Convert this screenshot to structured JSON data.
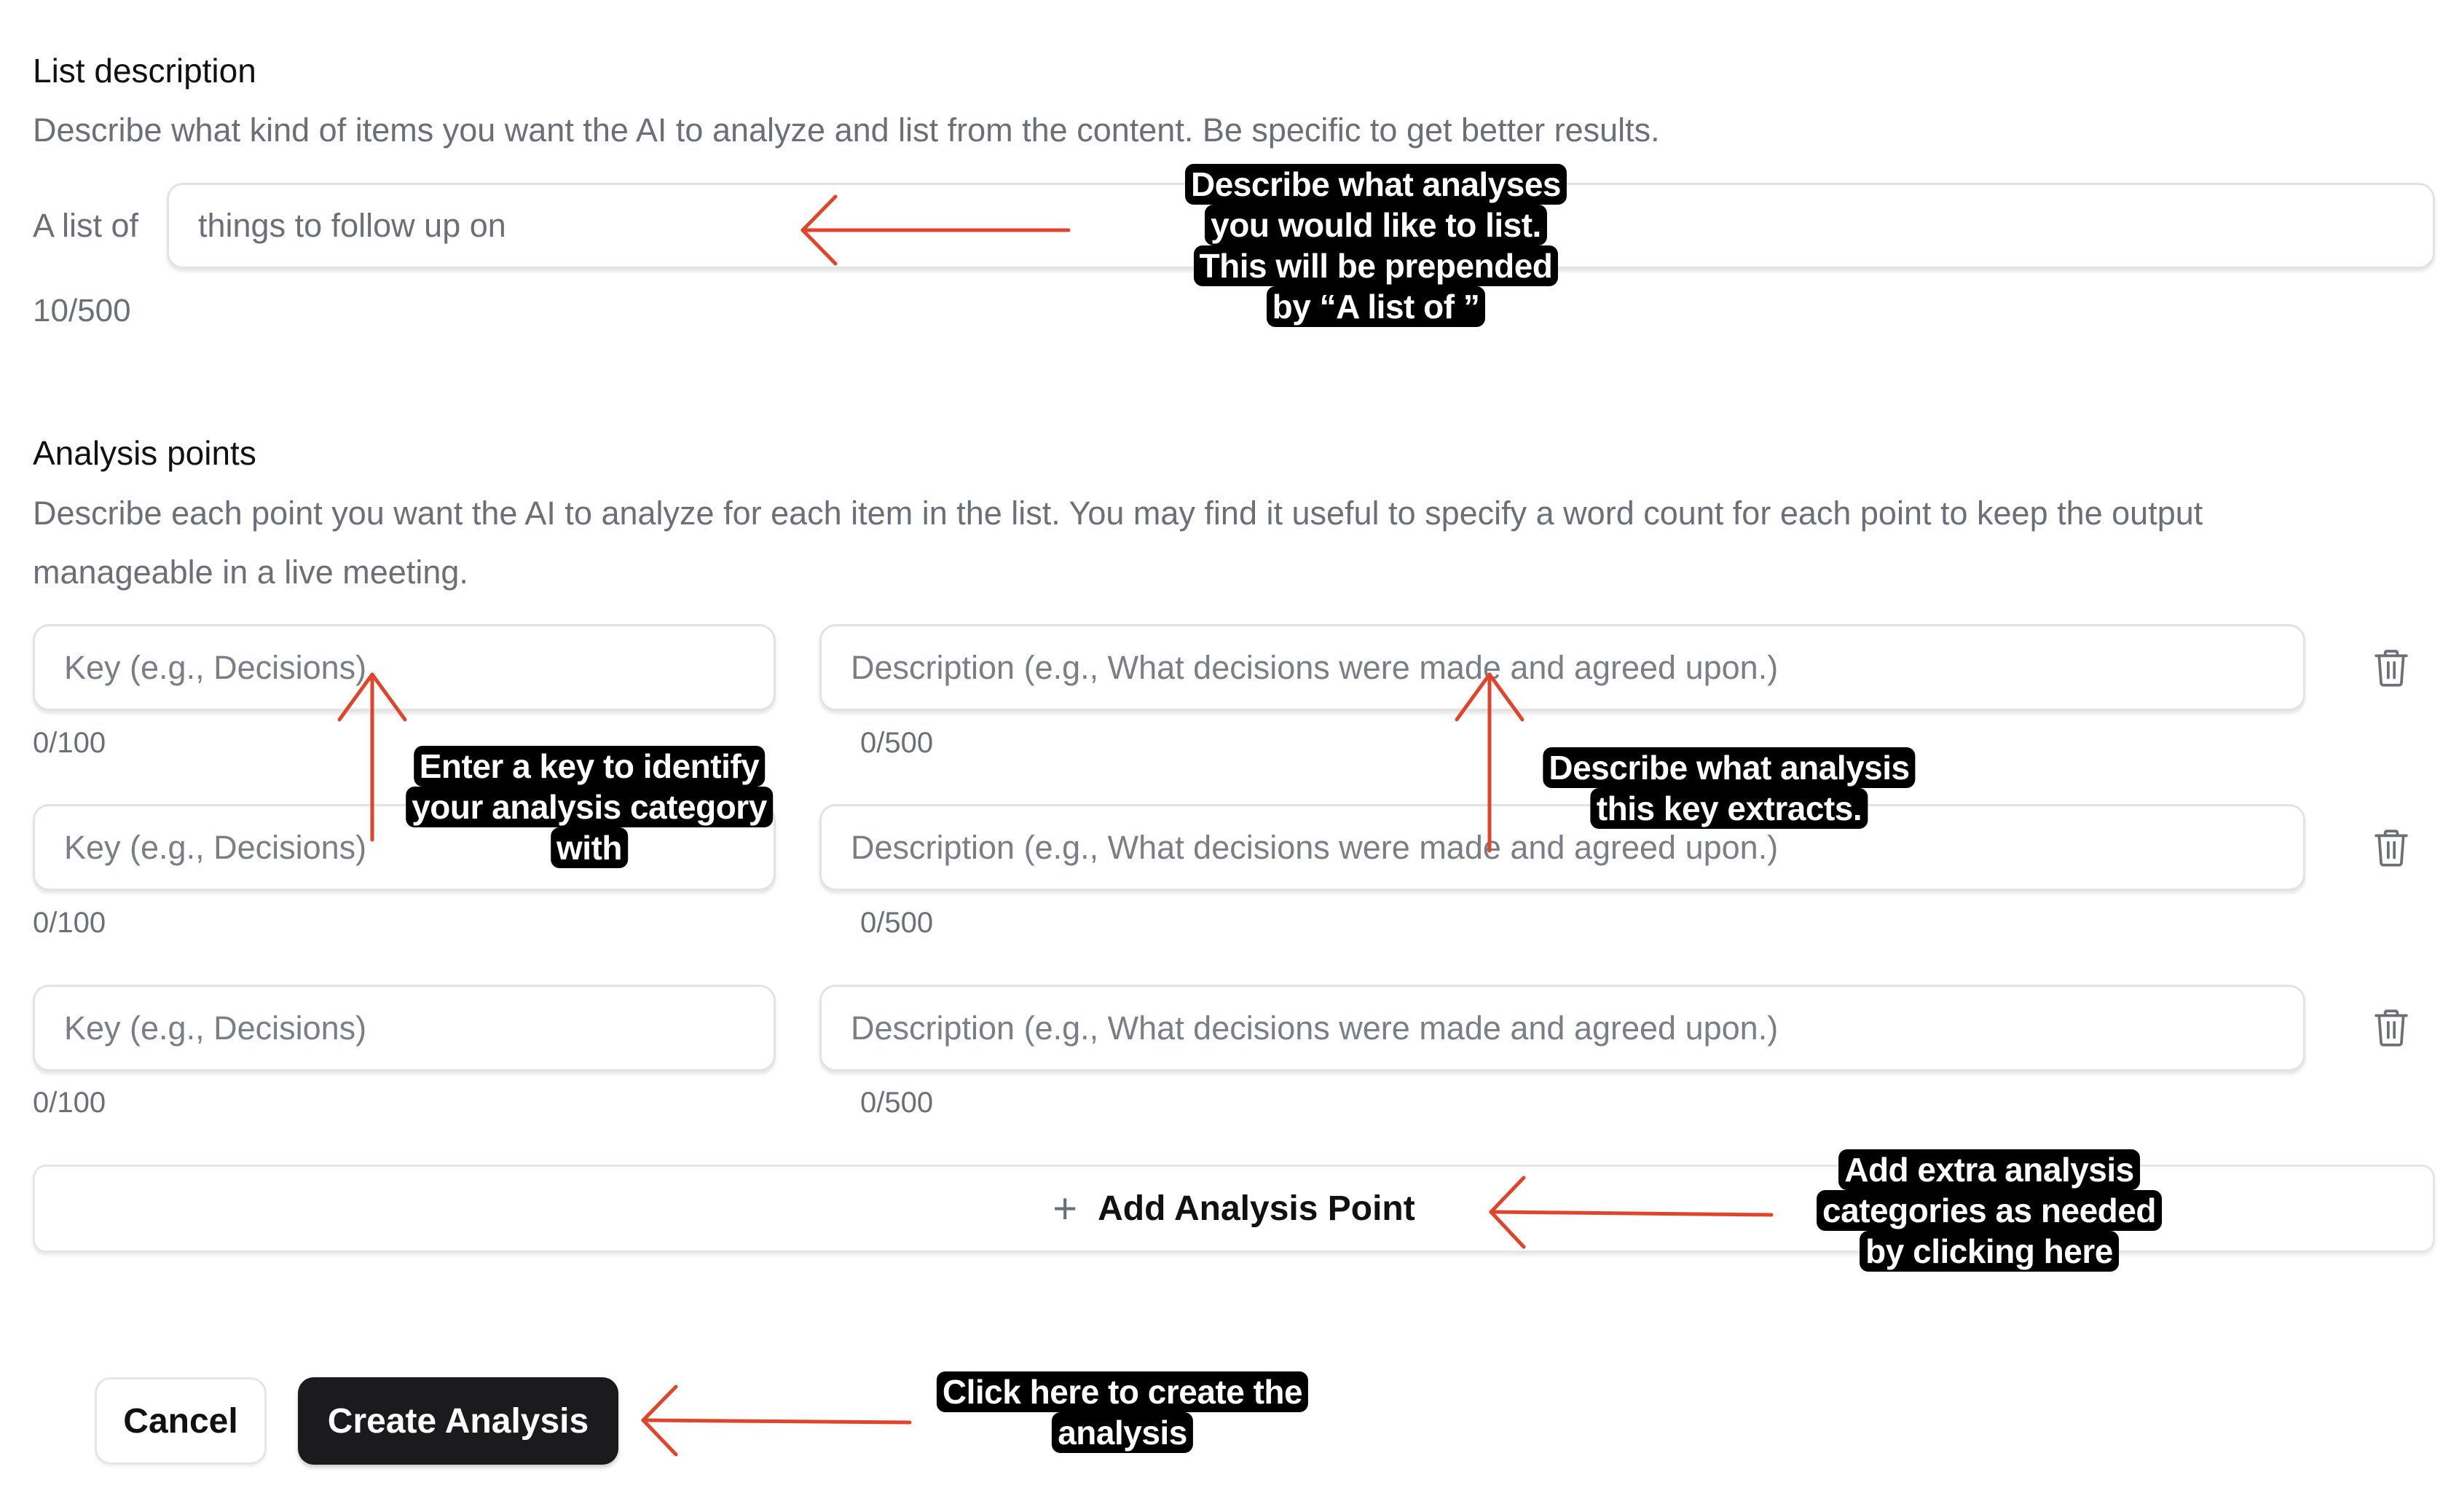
{
  "list_section": {
    "title": "List description",
    "help": "Describe what kind of items you want the AI to analyze and list from the content. Be specific to get better results.",
    "prefix": "A list of",
    "input_value": "things to follow up on",
    "counter": "10/500"
  },
  "points_section": {
    "title": "Analysis points",
    "help_line1": "Describe each point you want the AI to analyze for each item in the list. You may find it useful to specify a word count for each point to keep the output",
    "help_line2": "manageable in a live meeting.",
    "rows": [
      {
        "key_placeholder": "Key (e.g., Decisions)",
        "desc_placeholder": "Description (e.g., What decisions were made and agreed upon.)",
        "key_counter": "0/100",
        "desc_counter": "0/500",
        "delete_icon": "trash-icon"
      },
      {
        "key_placeholder": "Key (e.g., Decisions)",
        "desc_placeholder": "Description (e.g., What decisions were made and agreed upon.)",
        "key_counter": "0/100",
        "desc_counter": "0/500",
        "delete_icon": "trash-icon"
      },
      {
        "key_placeholder": "Key (e.g., Decisions)",
        "desc_placeholder": "Description (e.g., What decisions were made and agreed upon.)",
        "key_counter": "0/100",
        "desc_counter": "0/500",
        "delete_icon": "trash-icon"
      }
    ],
    "add_button_icon": "plus-icon",
    "add_button_label": "Add Analysis Point"
  },
  "actions": {
    "cancel_label": "Cancel",
    "create_label": "Create Analysis"
  },
  "annotations": {
    "color": "#e0452c",
    "list_input": [
      "Describe what analyses",
      "you would like to list.",
      "This will be prepended",
      "by “A list of ”"
    ],
    "key_input": [
      "Enter a key to identify",
      "your analysis category",
      "with"
    ],
    "desc_input": [
      "Describe what analysis",
      "this key extracts."
    ],
    "add_button": [
      "Add extra analysis",
      "categories as needed",
      "by clicking here"
    ],
    "create_button": [
      "Click here to create the",
      "analysis"
    ]
  }
}
